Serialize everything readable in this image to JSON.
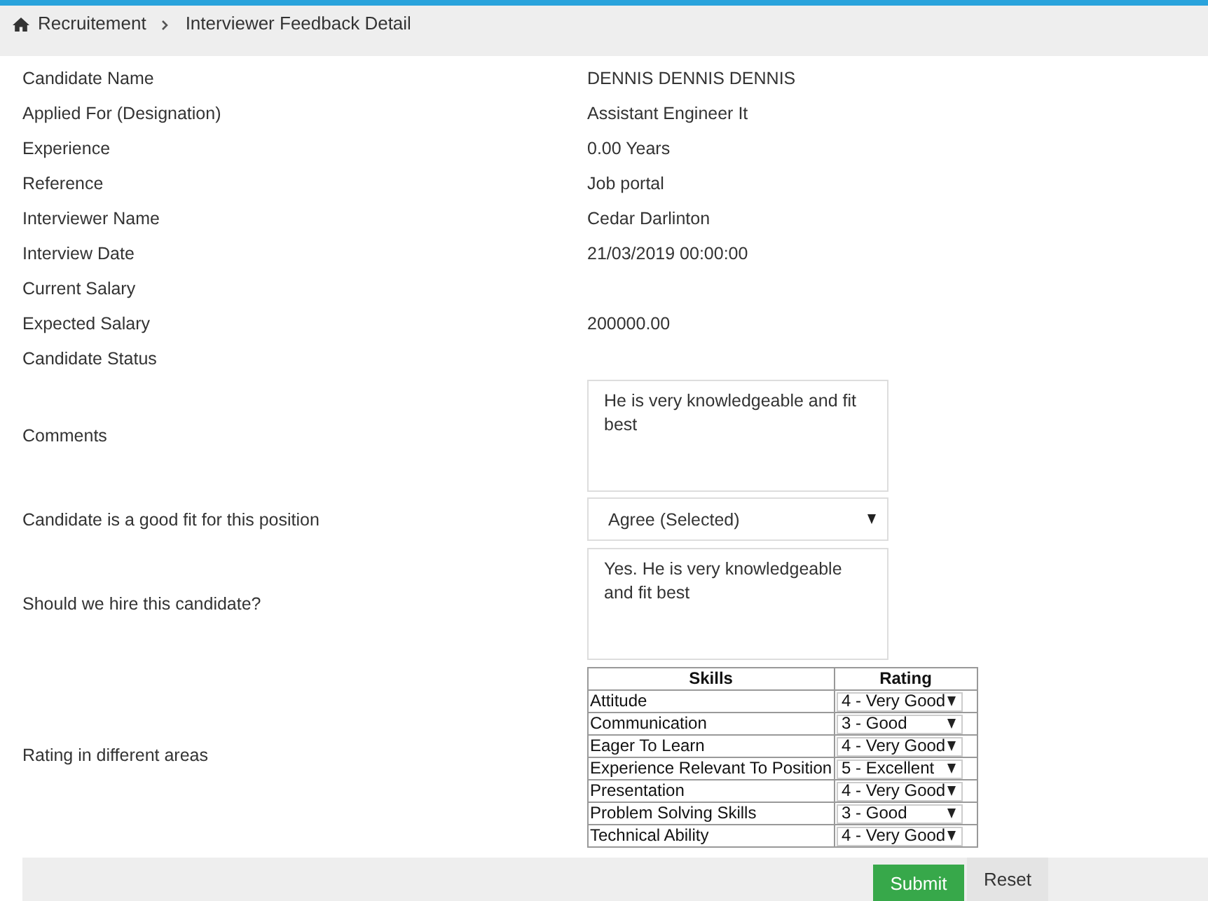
{
  "breadcrumb": {
    "items": [
      "Recruitement",
      "Interviewer Feedback Detail"
    ]
  },
  "fields": [
    {
      "kind": "text",
      "label": "Candidate Name",
      "value": "DENNIS DENNIS DENNIS"
    },
    {
      "kind": "text",
      "label": "Applied For (Designation)",
      "value": "Assistant Engineer It"
    },
    {
      "kind": "text",
      "label": "Experience",
      "value": "0.00 Years"
    },
    {
      "kind": "text",
      "label": "Reference",
      "value": "Job portal"
    },
    {
      "kind": "text",
      "label": "Interviewer Name",
      "value": "Cedar Darlinton"
    },
    {
      "kind": "text",
      "label": "Interview Date",
      "value": "21/03/2019 00:00:00"
    },
    {
      "kind": "text",
      "label": "Current Salary"
    },
    {
      "kind": "text",
      "label": "Expected Salary",
      "value": "200000.00"
    },
    {
      "kind": "text",
      "label": "Candidate Status"
    },
    {
      "kind": "textarea",
      "label": "Comments",
      "value": "He is very knowledgeable and fit best"
    },
    {
      "kind": "select",
      "label": "Candidate is a good fit for this position",
      "value": "Agree (Selected)"
    },
    {
      "kind": "textarea",
      "label": "Should we hire this candidate?",
      "value": "Yes. He is very knowledgeable and fit best"
    },
    {
      "kind": "rating_table",
      "label": "Rating in different areas",
      "columns": [
        "Skills",
        "Rating"
      ],
      "rows": [
        {
          "skill": "Attitude",
          "rating": "4 - Very Good"
        },
        {
          "skill": "Communication",
          "rating": "3 - Good"
        },
        {
          "skill": "Eager To Learn",
          "rating": "4 - Very Good"
        },
        {
          "skill": "Experience Relevant To Position",
          "rating": "5 - Excellent"
        },
        {
          "skill": "Presentation",
          "rating": "4 - Very Good"
        },
        {
          "skill": "Problem Solving Skills",
          "rating": "3 - Good"
        },
        {
          "skill": "Technical Ability",
          "rating": "4 - Very Good"
        }
      ]
    }
  ],
  "buttons": [
    {
      "kind": "primary",
      "label": "Submit"
    },
    {
      "kind": "default",
      "label": "Reset"
    }
  ]
}
